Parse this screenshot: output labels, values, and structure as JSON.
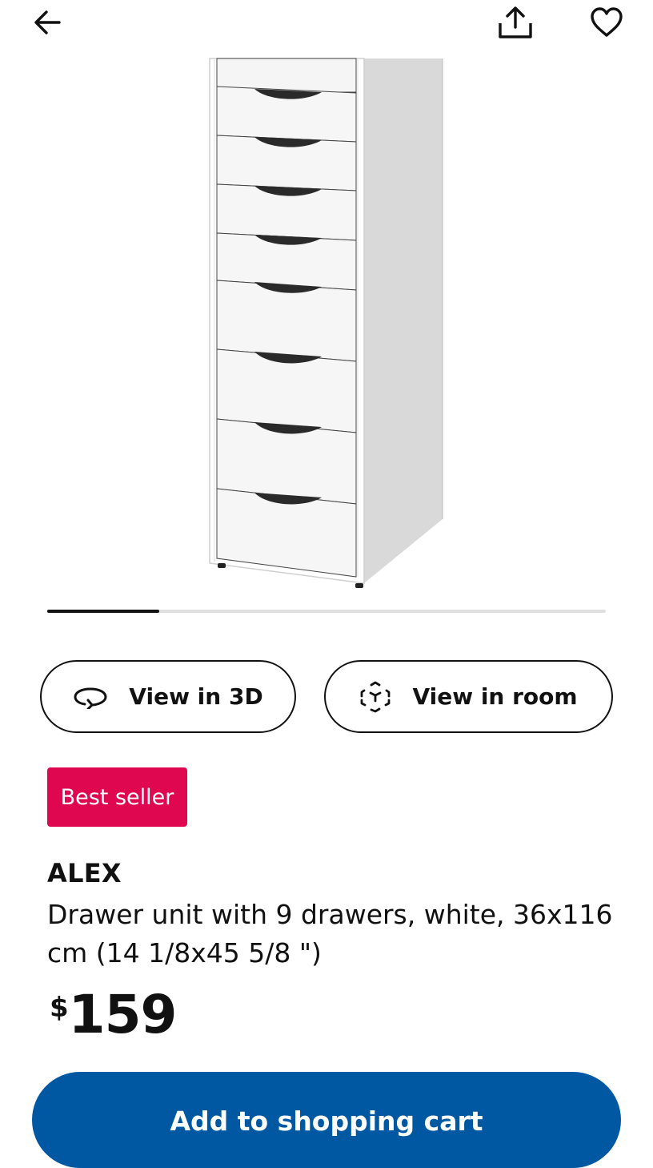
{
  "header": {
    "back_icon": "arrow-left-icon",
    "share_icon": "share-icon",
    "favorite_icon": "heart-icon"
  },
  "gallery": {
    "image_subject": "drawer-unit-product-image",
    "progress": 0.2
  },
  "actions": {
    "view_3d": {
      "label": "View in 3D",
      "icon": "rotate-3d-icon"
    },
    "view_room": {
      "label": "View in room",
      "icon": "ar-cube-icon"
    }
  },
  "product": {
    "badge": "Best seller",
    "name": "ALEX",
    "description": "Drawer unit with 9 drawers, white, 36x116 cm (14 1/8x45 5/8 \")",
    "price_currency": "$",
    "price_value": "159"
  },
  "cart": {
    "label": "Add to shopping cart"
  },
  "colors": {
    "badge": "#e00751",
    "primary": "#0058a3",
    "text": "#111111"
  }
}
